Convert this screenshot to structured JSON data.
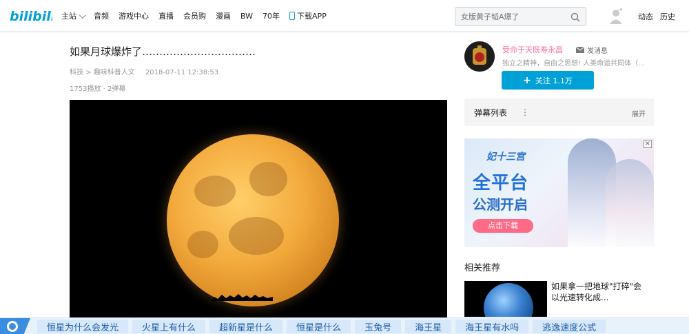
{
  "header": {
    "logo_text": "bilibili",
    "nav": [
      {
        "label": "主站"
      },
      {
        "label": "音频"
      },
      {
        "label": "游戏中心"
      },
      {
        "label": "直播"
      },
      {
        "label": "会员购"
      },
      {
        "label": "漫画"
      },
      {
        "label": "BW"
      },
      {
        "label": "70年"
      },
      {
        "label": "下载APP"
      }
    ],
    "search_placeholder": "女版黄子韬A爆了",
    "links": {
      "dynamic": "动态",
      "history": "历史"
    }
  },
  "video": {
    "title": "如果月球爆炸了……………………………",
    "category": "科技",
    "subcategory": "趣味科普人文",
    "date": "2018-07-11 12:38:53",
    "stats": "1753播放 · 2弹幕"
  },
  "uploader": {
    "name": "受命于天既寿永昌",
    "message_label": "发消息",
    "description": "独立之精神，自由之思想! 人类命运共同体（...",
    "follow_label": "关注 1.1万"
  },
  "danmaku": {
    "label": "弹幕列表",
    "expand": "展开"
  },
  "ad": {
    "brand": "妃十三宫",
    "headline1": "全平台",
    "headline2": "公测开启",
    "cta": "点击下载",
    "close": "×"
  },
  "related": {
    "title": "相关推荐",
    "item_text": "如果拿一把地球\"打碎\"会\n以光速转化成..."
  },
  "bottom_bar": {
    "keywords": [
      "恒星为什么会发光",
      "火星上有什么",
      "超新星是什么",
      "恒星是什么",
      "玉兔号",
      "海王星",
      "海王星有水吗",
      "逃逸速度公式"
    ]
  },
  "colors": {
    "accent": "#00a1d6",
    "pink": "#fb7299",
    "bottom_accent": "#3b8de0"
  }
}
